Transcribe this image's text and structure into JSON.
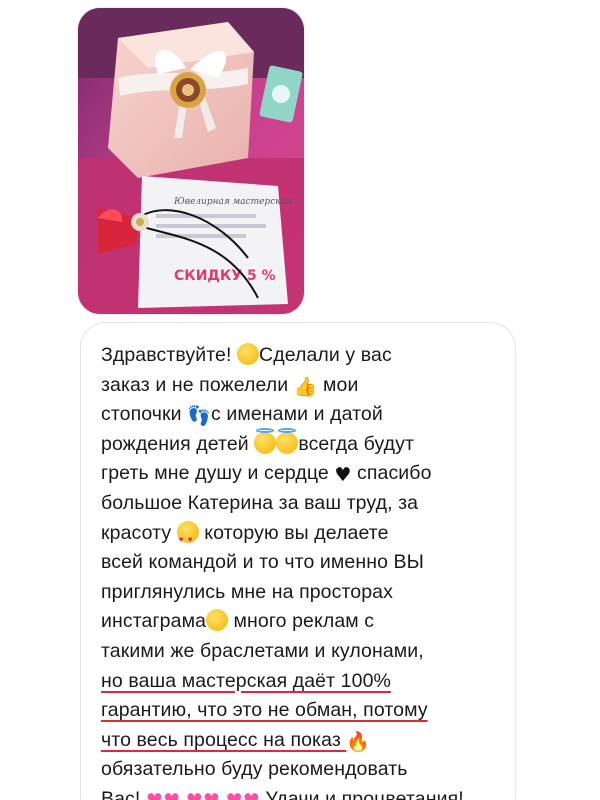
{
  "photo": {
    "lettering": [
      "Ювелирная мастерская",
      "СКИДКУ 5 %"
    ]
  },
  "message": {
    "lines": [
      [
        "Здравствуйте! ",
        {
          "emoji": "smiling-face-icon"
        },
        "Сделали у вас"
      ],
      [
        "заказ и не пожелели ",
        {
          "emoji": "thumbs-up-icon"
        },
        "  мои"
      ],
      [
        "стопочки ",
        {
          "emoji": "footprints-icon"
        },
        "с именами и датой"
      ],
      [
        "рождения детей ",
        {
          "emoji": "halo-face-icon"
        },
        {
          "emoji": "halo-face-icon"
        },
        "всегда будут"
      ],
      [
        "греть мне душу и сердце ",
        {
          "emoji": "black-heart-icon"
        },
        " спасибо"
      ],
      [
        "большое Катерина за ваш труд, за"
      ],
      [
        "красоту ",
        {
          "emoji": "heart-eyes-icon"
        },
        "  которую вы делаете"
      ],
      [
        "всей командой и то что именно ВЫ"
      ],
      [
        "приглянулись мне на просторах"
      ],
      [
        "инстаграма",
        {
          "emoji": "smiling-face-icon"
        },
        "  много реклам с"
      ],
      [
        "такими же браслетами и кулонами,"
      ],
      [
        {
          "u": "но ваша мастерская даёт 100%"
        }
      ],
      [
        {
          "u": "гарантию, что это не обман, потому"
        }
      ],
      [
        {
          "u": "что весь процесс на показ "
        },
        {
          "emoji": "fire-icon"
        }
      ],
      [
        "обязательно буду рекомендовать"
      ],
      [
        "Вас! ",
        {
          "emoji": "two-hearts-icon"
        },
        " ",
        {
          "emoji": "two-hearts-icon"
        },
        " ",
        {
          "emoji": "two-hearts-icon"
        },
        "  Удачи и процветания!"
      ]
    ]
  },
  "colors": {
    "bubble_border": "#e4e4e4",
    "text": "#1a1a1a",
    "underline": "#d92b3a"
  }
}
